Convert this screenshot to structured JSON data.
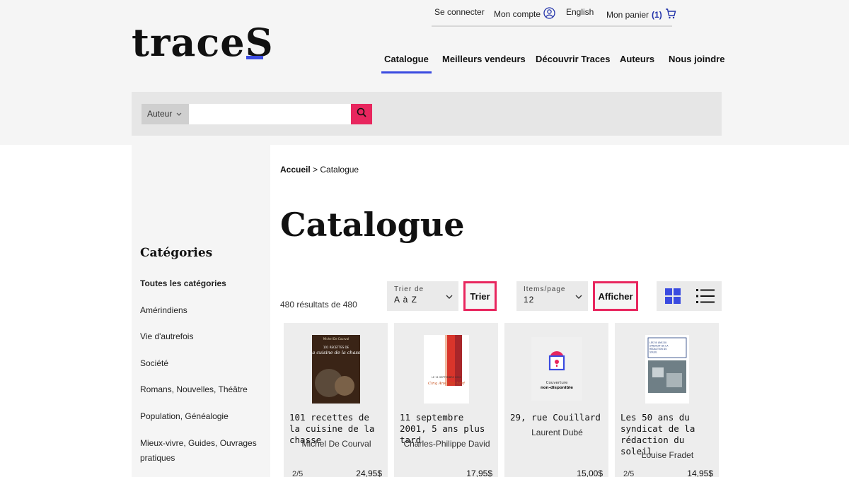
{
  "brand": {
    "logo_text": "traceS",
    "accent": "#3a4be0",
    "highlight": "#e8265e"
  },
  "util_bar": {
    "login": "Se connecter",
    "account": "Mon compte",
    "language": "English",
    "cart_label": "Mon panier",
    "cart_count": "(1)"
  },
  "nav": [
    {
      "label": "Catalogue",
      "active": true
    },
    {
      "label": "Meilleurs vendeurs",
      "active": false
    },
    {
      "label": "Découvrir Traces",
      "active": false
    },
    {
      "label": "Auteurs",
      "active": false
    },
    {
      "label": "Nous joindre",
      "active": false
    }
  ],
  "search": {
    "filter": "Auteur",
    "value": "",
    "placeholder": ""
  },
  "sidebar": {
    "title": "Catégories",
    "items": [
      "Toutes les catégories",
      "Amérindiens",
      "Vie d'autrefois",
      "Société",
      "Romans, Nouvelles, Théâtre",
      "Population, Généalogie",
      "Mieux-vivre, Guides, Ouvrages pratiques"
    ]
  },
  "breadcrumb": {
    "home": "Accueil",
    "separator": " > ",
    "current": "Catalogue"
  },
  "page_title": "Catalogue",
  "results_text": "480 résultats de 480",
  "sort": {
    "caption": "Trier de",
    "value": "A à Z",
    "button": "Trier"
  },
  "items_per_page": {
    "caption": "Items/page",
    "value": "12",
    "button": "Afficher"
  },
  "books": [
    {
      "title": "101 recettes de la cuisine de la chasse",
      "author": "Michel De Courval",
      "rating": "2/5",
      "price": "24,95$",
      "cover_top": "Michel De Courval",
      "cover_title": "La cuisine de la chasse",
      "cover_sub": "101 RECETTES DE"
    },
    {
      "title": "11 septembre 2001, 5 ans plus tard",
      "author": "Charles-Philippe David",
      "rating": "",
      "price": "17,95$",
      "cover_title": "Cinq Ans plus tard",
      "cover_sub": "LE 11 SEPTEMBRE 2001"
    },
    {
      "title": "29, rue Couillard",
      "author": "Laurent Dubé",
      "rating": "",
      "price": "15,00$",
      "cover_top": "Couverture",
      "cover_sub": "non-disponible"
    },
    {
      "title": "Les 50 ans du syndicat de la rédaction du soleil",
      "author": "Louise Fradet",
      "rating": "2/5",
      "price": "14,95$",
      "cover_title": "LES 50 ANS DU SYNDICAT DE LA RÉDACTION DU SOLEIL"
    }
  ]
}
